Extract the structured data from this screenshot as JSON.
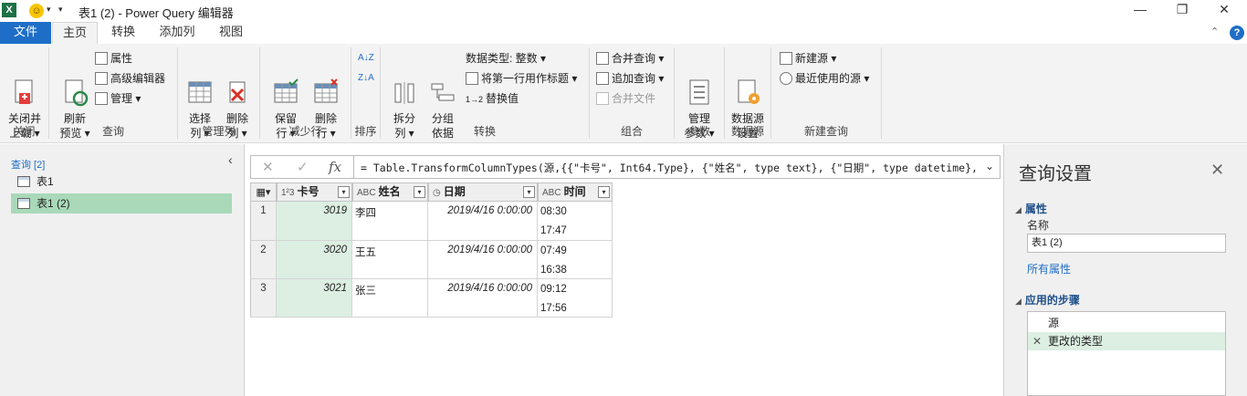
{
  "window": {
    "title": "表1 (2) - Power Query 编辑器",
    "app_icon": "X"
  },
  "tabs": [
    {
      "label": "文件"
    },
    {
      "label": "主页"
    },
    {
      "label": "转换"
    },
    {
      "label": "添加列"
    },
    {
      "label": "视图"
    }
  ],
  "help_label": "?",
  "ribbon": {
    "close": {
      "big": "关闭并\n上载 ▾",
      "group": "关闭"
    },
    "query": {
      "big": "刷新\n预览 ▾",
      "properties": "属性",
      "advanced_editor": "高级编辑器",
      "manage": "管理 ▾",
      "group": "查询"
    },
    "manage_cols": {
      "choose": "选择\n列 ▾",
      "remove": "删除\n列 ▾",
      "group": "管理列"
    },
    "reduce_rows": {
      "keep": "保留\n行 ▾",
      "remove": "删除\n行 ▾",
      "group": "减少行"
    },
    "sort": {
      "group": "排序"
    },
    "transform": {
      "split": "拆分\n列 ▾",
      "group_by": "分组\n依据",
      "data_type": "数据类型: 整数 ▾",
      "first_row_header": "将第一行用作标题 ▾",
      "replace": "替换值",
      "group": "转换"
    },
    "combine": {
      "merge": "合并查询 ▾",
      "append": "追加查询 ▾",
      "combine_files": "合并文件",
      "group": "组合"
    },
    "params": {
      "manage": "管理\n参数 ▾",
      "group": "参数"
    },
    "datasource": {
      "settings": "数据源\n设置",
      "group": "数据源"
    },
    "new_query": {
      "new_source": "新建源 ▾",
      "recent": "最近使用的源 ▾",
      "group": "新建查询"
    }
  },
  "queries": {
    "header": "查询 [2]",
    "items": [
      {
        "label": "表1"
      },
      {
        "label": "表1 (2)"
      }
    ]
  },
  "formula": {
    "fx": "fx",
    "text": "= Table.TransformColumnTypes(源,{{\"卡号\", Int64.Type}, {\"姓名\", type text}, {\"日期\", type datetime},"
  },
  "table": {
    "columns": [
      {
        "type": "1²3",
        "name": "卡号"
      },
      {
        "type": "ABC",
        "name": "姓名"
      },
      {
        "type": "◷",
        "name": "日期"
      },
      {
        "type": "ABC",
        "name": "时间"
      }
    ],
    "rows": [
      {
        "n": "1",
        "card": "3019",
        "name": "李四",
        "date": "2019/4/16 0:00:00",
        "t1": "08:30",
        "t2": "17:47"
      },
      {
        "n": "2",
        "card": "3020",
        "name": "王五",
        "date": "2019/4/16 0:00:00",
        "t1": "07:49",
        "t2": "16:38"
      },
      {
        "n": "3",
        "card": "3021",
        "name": "张三",
        "date": "2019/4/16 0:00:00",
        "t1": "09:12",
        "t2": "17:56"
      }
    ]
  },
  "settings": {
    "title": "查询设置",
    "properties_label": "属性",
    "name_label": "名称",
    "name_value": "表1 (2)",
    "all_properties": "所有属性",
    "steps_label": "应用的步骤",
    "steps": [
      {
        "label": "源"
      },
      {
        "label": "更改的类型"
      }
    ]
  }
}
